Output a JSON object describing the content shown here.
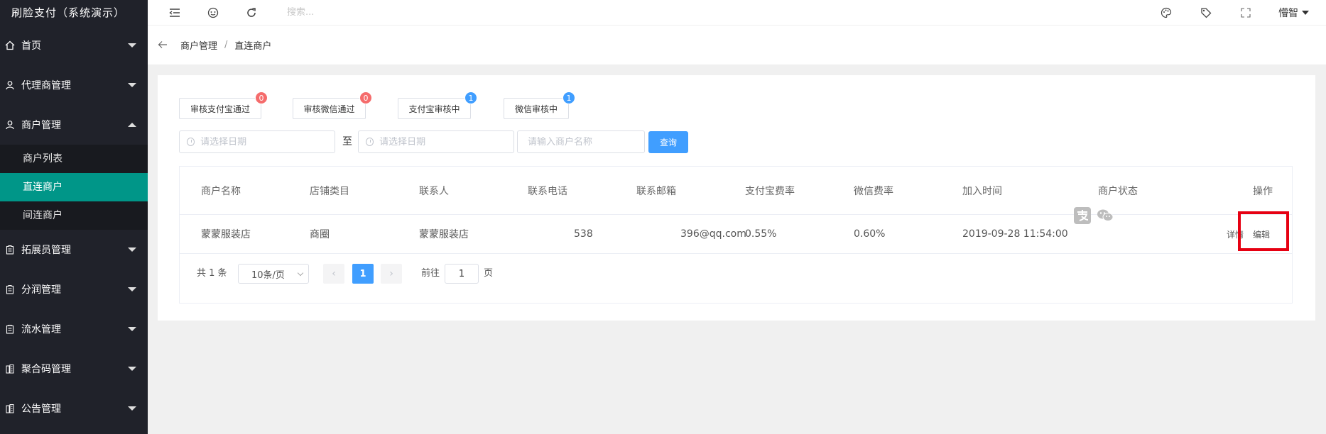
{
  "app": {
    "brand": "刷脸支付（系统演示）"
  },
  "sidebar": {
    "items": [
      {
        "label": "首页"
      },
      {
        "label": "代理商管理"
      },
      {
        "label": "商户管理",
        "expanded": true
      },
      {
        "label": "拓展员管理"
      },
      {
        "label": "分润管理"
      },
      {
        "label": "流水管理"
      },
      {
        "label": "聚合码管理"
      },
      {
        "label": "公告管理"
      }
    ],
    "submenu": [
      {
        "label": "商户列表"
      },
      {
        "label": "直连商户",
        "active": true
      },
      {
        "label": "间连商户"
      }
    ]
  },
  "header": {
    "search_placeholder": "搜索...",
    "user": "懵智"
  },
  "breadcrumb": {
    "parent": "商户管理",
    "sep": "/",
    "current": "直连商户"
  },
  "stats": [
    {
      "label": "审核支付宝通过",
      "count": "0",
      "color": "red"
    },
    {
      "label": "审核微信通过",
      "count": "0",
      "color": "red"
    },
    {
      "label": "支付宝审核中",
      "count": "1",
      "color": "blue"
    },
    {
      "label": "微信审核中",
      "count": "1",
      "color": "blue"
    }
  ],
  "filters": {
    "start_date_placeholder": "请选择日期",
    "to_label": "至",
    "end_date_placeholder": "请选择日期",
    "merchant_name_placeholder": "请输入商户名称",
    "query_label": "查询"
  },
  "table": {
    "columns": [
      "商户名称",
      "店铺类目",
      "联系人",
      "联系电话",
      "联系邮箱",
      "支付宝费率",
      "微信费率",
      "加入时间",
      "商户状态",
      "操作"
    ],
    "rows": [
      {
        "merchant_name": "蒙蒙服装店",
        "category": "商圈",
        "contact": "蒙蒙服装店",
        "phone": "538",
        "email": "396@qq.com",
        "alipay_rate": "0.55%",
        "wechat_rate": "0.60%",
        "join_time": "2019-09-28 11:54:00",
        "actions": {
          "detail": "详情",
          "edit": "编辑"
        }
      }
    ]
  },
  "pagination": {
    "total": "共 1 条",
    "page_size": "10条/页",
    "current_page": "1",
    "goto_prefix": "前往",
    "goto_value": "1",
    "goto_suffix": "页"
  },
  "colors": {
    "sidebar_bg": "#20222a",
    "active_item": "#009688",
    "primary": "#409eff",
    "badge_red": "#f56c6c",
    "highlight": "#e60012"
  }
}
